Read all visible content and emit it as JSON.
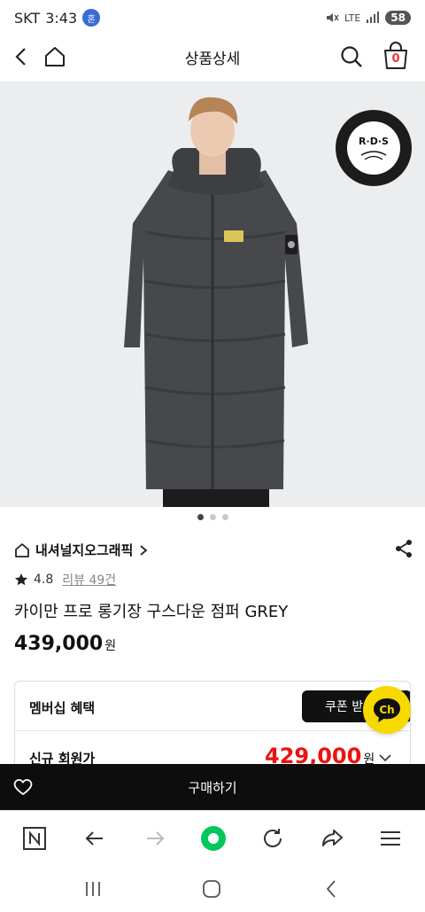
{
  "status_bar": {
    "carrier": "SKT",
    "time": "3:43",
    "app_badge": "혼",
    "network": "LTE",
    "battery": "58"
  },
  "header": {
    "title": "상품상세",
    "cart_count": "0"
  },
  "product": {
    "image_badge_text": "R·D·S",
    "image_count": 3,
    "active_image": 1,
    "brand": "내셔널지오그래픽",
    "rating": "4.8",
    "review_label": "리뷰 49건",
    "name": "카이만 프로 롱기장 구스다운 점퍼 GREY",
    "price": "439,000",
    "currency": "원"
  },
  "benefit": {
    "membership_label": "멤버십 혜택",
    "coupon_button": "쿠폰 받기",
    "new_member_label": "신규 회원가",
    "new_member_price": "429,000",
    "currency": "원"
  },
  "chat_button": "Ch",
  "buy_bar": {
    "buy_label": "구매하기"
  },
  "colors": {
    "accent_red": "#e11111",
    "chat_yellow": "#f7d900",
    "browser_green": "#03c75a"
  }
}
